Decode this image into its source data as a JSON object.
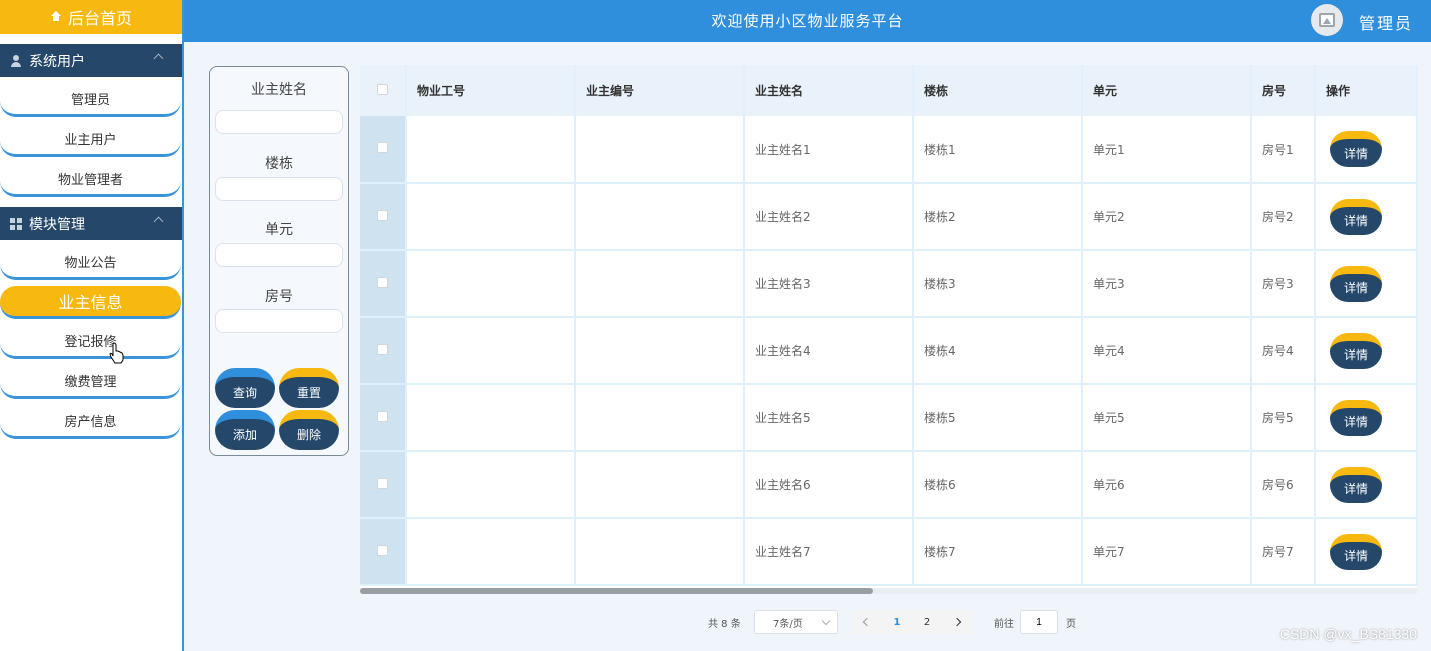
{
  "sidebar": {
    "home_label": "后台首页",
    "groups": [
      {
        "title": "系统用户",
        "items": [
          "管理员",
          "业主用户",
          "物业管理者"
        ]
      },
      {
        "title": "模块管理",
        "items": [
          "物业公告",
          "业主信息",
          "登记报修",
          "缴费管理",
          "房产信息"
        ]
      }
    ],
    "active_item": "业主信息"
  },
  "topbar": {
    "title": "欢迎使用小区物业服务平台",
    "user_label": "管理员"
  },
  "search": {
    "fields": [
      "业主姓名",
      "楼栋",
      "单元",
      "房号"
    ],
    "buttons": {
      "query": "查询",
      "reset": "重置",
      "add": "添加",
      "delete": "删除"
    }
  },
  "table": {
    "columns": [
      "物业工号",
      "业主编号",
      "业主姓名",
      "楼栋",
      "单元",
      "房号",
      "操作"
    ],
    "rows": [
      {
        "staff_no": "",
        "owner_no": "",
        "name": "业主姓名1",
        "building": "楼栋1",
        "unit": "单元1",
        "room": "房号1"
      },
      {
        "staff_no": "",
        "owner_no": "",
        "name": "业主姓名2",
        "building": "楼栋2",
        "unit": "单元2",
        "room": "房号2"
      },
      {
        "staff_no": "",
        "owner_no": "",
        "name": "业主姓名3",
        "building": "楼栋3",
        "unit": "单元3",
        "room": "房号3"
      },
      {
        "staff_no": "",
        "owner_no": "",
        "name": "业主姓名4",
        "building": "楼栋4",
        "unit": "单元4",
        "room": "房号4"
      },
      {
        "staff_no": "",
        "owner_no": "",
        "name": "业主姓名5",
        "building": "楼栋5",
        "unit": "单元5",
        "room": "房号5"
      },
      {
        "staff_no": "",
        "owner_no": "",
        "name": "业主姓名6",
        "building": "楼栋6",
        "unit": "单元6",
        "room": "房号6"
      },
      {
        "staff_no": "",
        "owner_no": "",
        "name": "业主姓名7",
        "building": "楼栋7",
        "unit": "单元7",
        "room": "房号7"
      }
    ],
    "action_label": "详情"
  },
  "pagination": {
    "total": "共 8 条",
    "page_size": "7条/页",
    "pages": [
      "1",
      "2"
    ],
    "current_page": "1",
    "goto_label": "前往",
    "goto_value": "1",
    "page_unit": "页"
  },
  "watermark": "CSDN @vx_BS81330",
  "colors": {
    "primary": "#2f8fdc",
    "accent": "#f7b90f",
    "dark": "#24476a"
  }
}
